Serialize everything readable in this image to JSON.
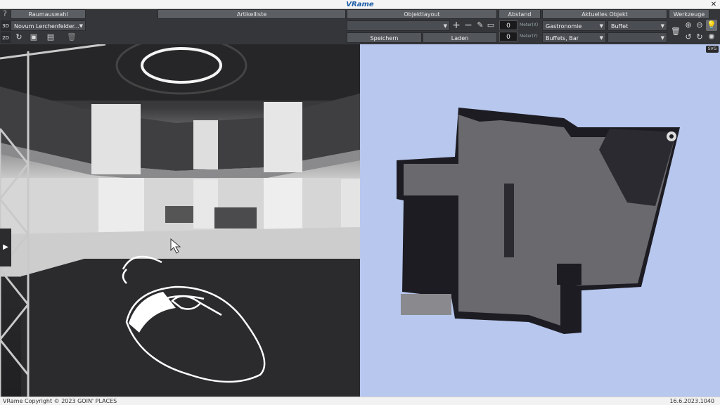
{
  "window": {
    "title": "VRame",
    "close_icon": "close-icon"
  },
  "toolbar": {
    "help_label": "?",
    "mode_3d_label": "3D",
    "mode_2d_label": "2D",
    "room_select": {
      "header": "Raumauswahl",
      "value": "Novum Lerchenfelder..."
    },
    "article_list_header": "Artikelliste",
    "object_layout": {
      "header": "Objektlayout",
      "value": "",
      "save_label": "Speichern",
      "load_label": "Laden"
    },
    "distance": {
      "header": "Abstand",
      "x_value": "0",
      "x_unit": "Meter(X)",
      "y_value": "0",
      "y_unit": "Meter(Y)"
    },
    "current_object": {
      "header": "Aktuelles Objekt",
      "category_value": "Gastronomie",
      "type_value": "Buffet",
      "subcategory_value": "Buffets, Bar",
      "variant_value": ""
    },
    "tools_header": "Werkzeuge",
    "svg_badge": "SVG"
  },
  "view3d": {
    "expand_icon": "chevron-right-icon"
  },
  "status": {
    "copyright": "VRame Copyright © 2023 GOIN' PLACES",
    "version": "16.6.2023.1040"
  }
}
